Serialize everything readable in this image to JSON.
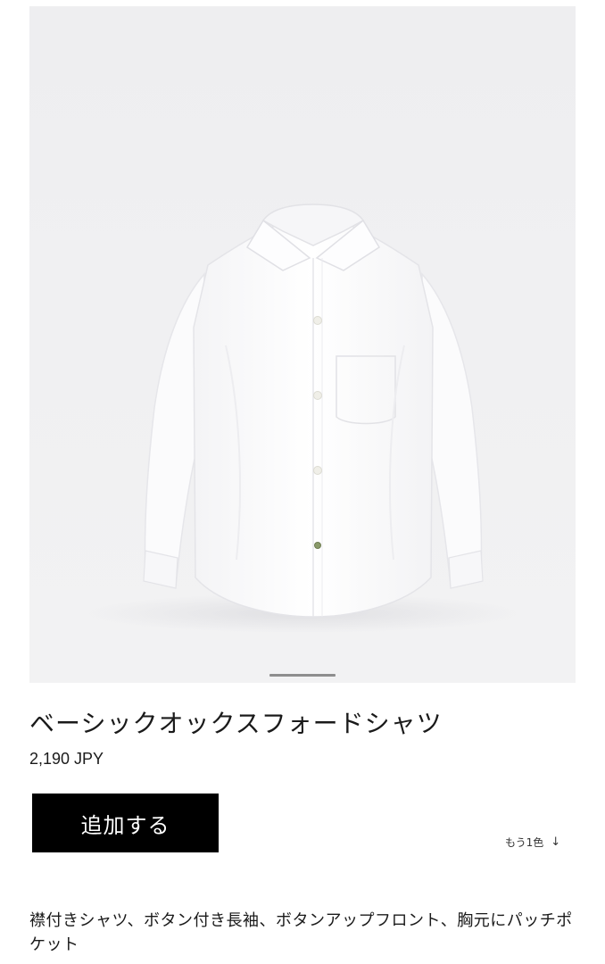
{
  "product": {
    "title": "ベーシックオックスフォードシャツ",
    "price": "2,190 JPY",
    "add_label": "追加する",
    "more_colors_label": "もう1色",
    "more_colors_icon": "arrow-down-icon",
    "description": "襟付きシャツ、ボタン付き長袖、ボタンアップフロント、胸元にパッチポケット"
  },
  "image": {
    "background_color": "#efeff1",
    "item_color": "#ffffff"
  },
  "colors": {
    "button_bg": "#000000",
    "button_text": "#ffffff",
    "text": "#1a1a1a",
    "indicator": "#8e8e8e"
  }
}
